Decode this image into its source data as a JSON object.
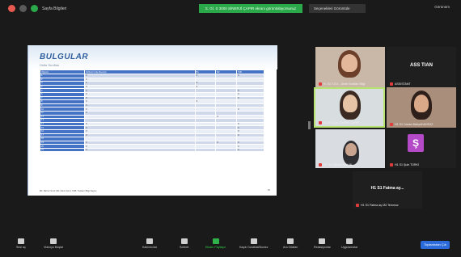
{
  "topbar": {
    "app_label": "Sayfa Bilgileri",
    "banner": "S. Gİ. S 3000 SİNERJİ ÇAPIR ekranı görüntülüyorsunuz",
    "presenter": "Seçenekleri Görüntüle",
    "view_label": "Görünüm"
  },
  "slide": {
    "title": "BULGULAR",
    "subtitle": "Ünite Sınıfları",
    "headers": [
      "Öğrenci",
      "Kültürel Ünite Becerisi",
      "B1",
      "B2",
      "TAB"
    ],
    "rows": [
      [
        "1",
        "X",
        "X",
        "",
        "X"
      ],
      [
        "2",
        "X",
        "",
        "",
        ""
      ],
      [
        "3",
        "X",
        "X",
        "",
        ""
      ],
      [
        "4",
        "X",
        "X",
        "",
        ""
      ],
      [
        "5",
        "X",
        "",
        "",
        "X"
      ],
      [
        "6",
        "X",
        "",
        "",
        "X"
      ],
      [
        "7",
        "X",
        "",
        "",
        "X"
      ],
      [
        "8",
        "X",
        "X",
        "",
        ""
      ],
      [
        "9",
        "X",
        "",
        "",
        ""
      ],
      [
        "10",
        "X",
        "",
        "",
        "X"
      ],
      [
        "11",
        "X",
        "",
        "",
        ""
      ],
      [
        "12",
        "",
        "",
        "X",
        ""
      ],
      [
        "13",
        "",
        "",
        "",
        ""
      ],
      [
        "14",
        "X",
        "",
        "",
        "X"
      ],
      [
        "15",
        "X",
        "",
        "",
        "X"
      ],
      [
        "16",
        "X",
        "",
        "",
        "X"
      ],
      [
        "17",
        "X",
        "",
        "",
        "X"
      ],
      [
        "18",
        "",
        "",
        "",
        ""
      ],
      [
        "19",
        "X",
        "",
        "X",
        "X"
      ],
      [
        "20",
        "X",
        "",
        "",
        "X"
      ],
      [
        "21",
        "X",
        "",
        "",
        "X"
      ]
    ],
    "footnote": "B1: Birinci Sınıf, B2: İkinci Sınıf, TAB: Toplam Bilgi Sayısı",
    "page": "15"
  },
  "participants": {
    "p1": {
      "name": "H. S1 T.S.K - Ünite Sınıfları Bilgi"
    },
    "p2": {
      "name": "ASSISTANT",
      "center": "ASS TIAN"
    },
    "p3": {
      "name": "H1 S1 Oya, ÖZERE ÇAPIR"
    },
    "p4": {
      "name": "H1 S1 Canan Bahçeli AKSOZ"
    },
    "p5": {
      "name": "H1 S1 Çiğdem ŞAHİN"
    },
    "p6": {
      "name": "H1 S1 Şule TÜRKİ",
      "avatar": "Ş"
    },
    "p7": {
      "name": "H1 S1 Fatma aş ÜÜ Temmuz",
      "center": "H1 S1 Fatma ay..."
    }
  },
  "toolbar": {
    "mute": "Sesi aç",
    "video": "Videoyu Başlat",
    "participants": "Katılımcılar",
    "chat": "Sohbet",
    "share": "Ekranı Paylaşın",
    "record": "Kaydı Duraklat/Durdur",
    "reactions": "Ara Odaları",
    "apps": "Reaksiyonlar",
    "whiteboard": "Uygulamalar",
    "end": "Toplantıdan Çık"
  }
}
